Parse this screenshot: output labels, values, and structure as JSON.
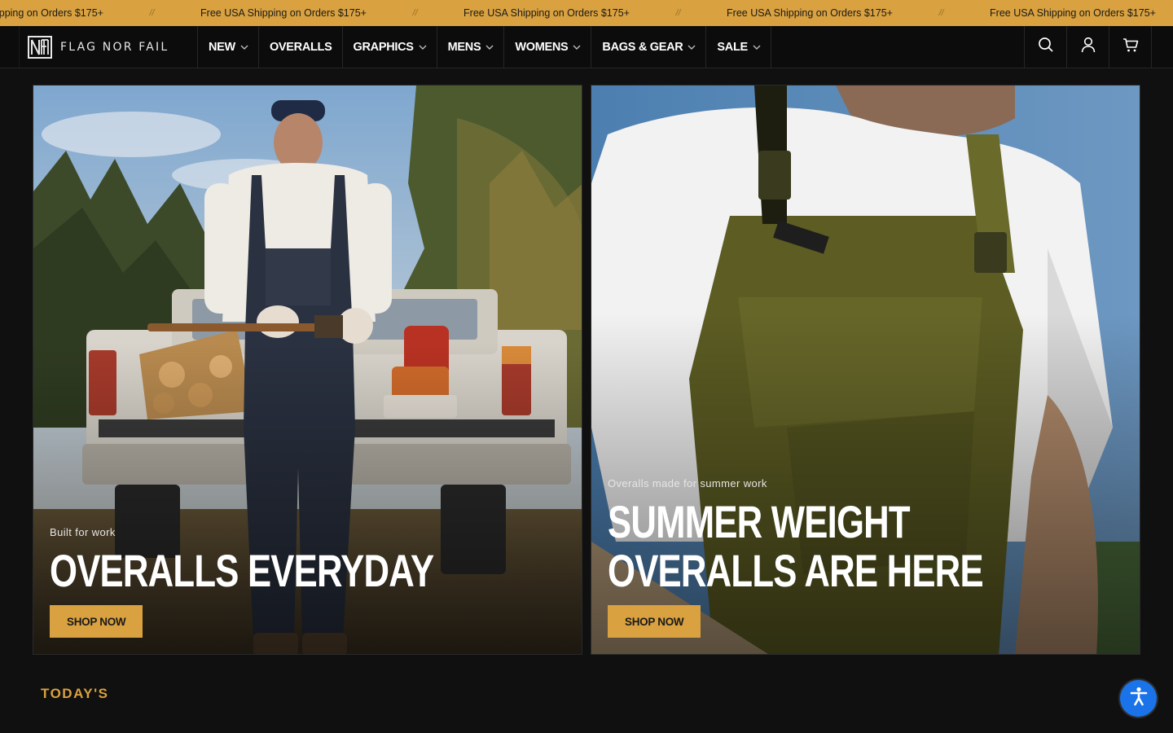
{
  "announcement": {
    "items": [
      "Free USA Shipping on Orders $175+",
      "Free USA Shipping on Orders $175+",
      "Free USA Shipping on Orders $175+",
      "Free USA Shipping on Orders $175+",
      "Free USA Shipping on Orders $175+"
    ],
    "separator": "//"
  },
  "header": {
    "brand": "FLAG NOR FAIL",
    "nav": [
      {
        "label": "NEW",
        "has_dropdown": true
      },
      {
        "label": "OVERALLS",
        "has_dropdown": false
      },
      {
        "label": "GRAPHICS",
        "has_dropdown": true
      },
      {
        "label": "MENS",
        "has_dropdown": true
      },
      {
        "label": "WOMENS",
        "has_dropdown": true
      },
      {
        "label": "BAGS & GEAR",
        "has_dropdown": true
      },
      {
        "label": "SALE",
        "has_dropdown": true
      }
    ],
    "icons": [
      "search-icon",
      "account-icon",
      "cart-icon"
    ]
  },
  "hero": {
    "left": {
      "eyebrow": "Built for work",
      "headline": "OVERALLS EVERYDAY",
      "cta": "SHOP NOW"
    },
    "right": {
      "eyebrow": "Overalls made for summer work",
      "headline": "SUMMER WEIGHT OVERALLS ARE HERE",
      "cta": "SHOP NOW"
    }
  },
  "section": {
    "title": "TODAY'S"
  },
  "colors": {
    "accent": "#d9a13f",
    "background": "#101010",
    "header_bg": "#0c0c0c",
    "accessibility_blue": "#1a73e8"
  }
}
